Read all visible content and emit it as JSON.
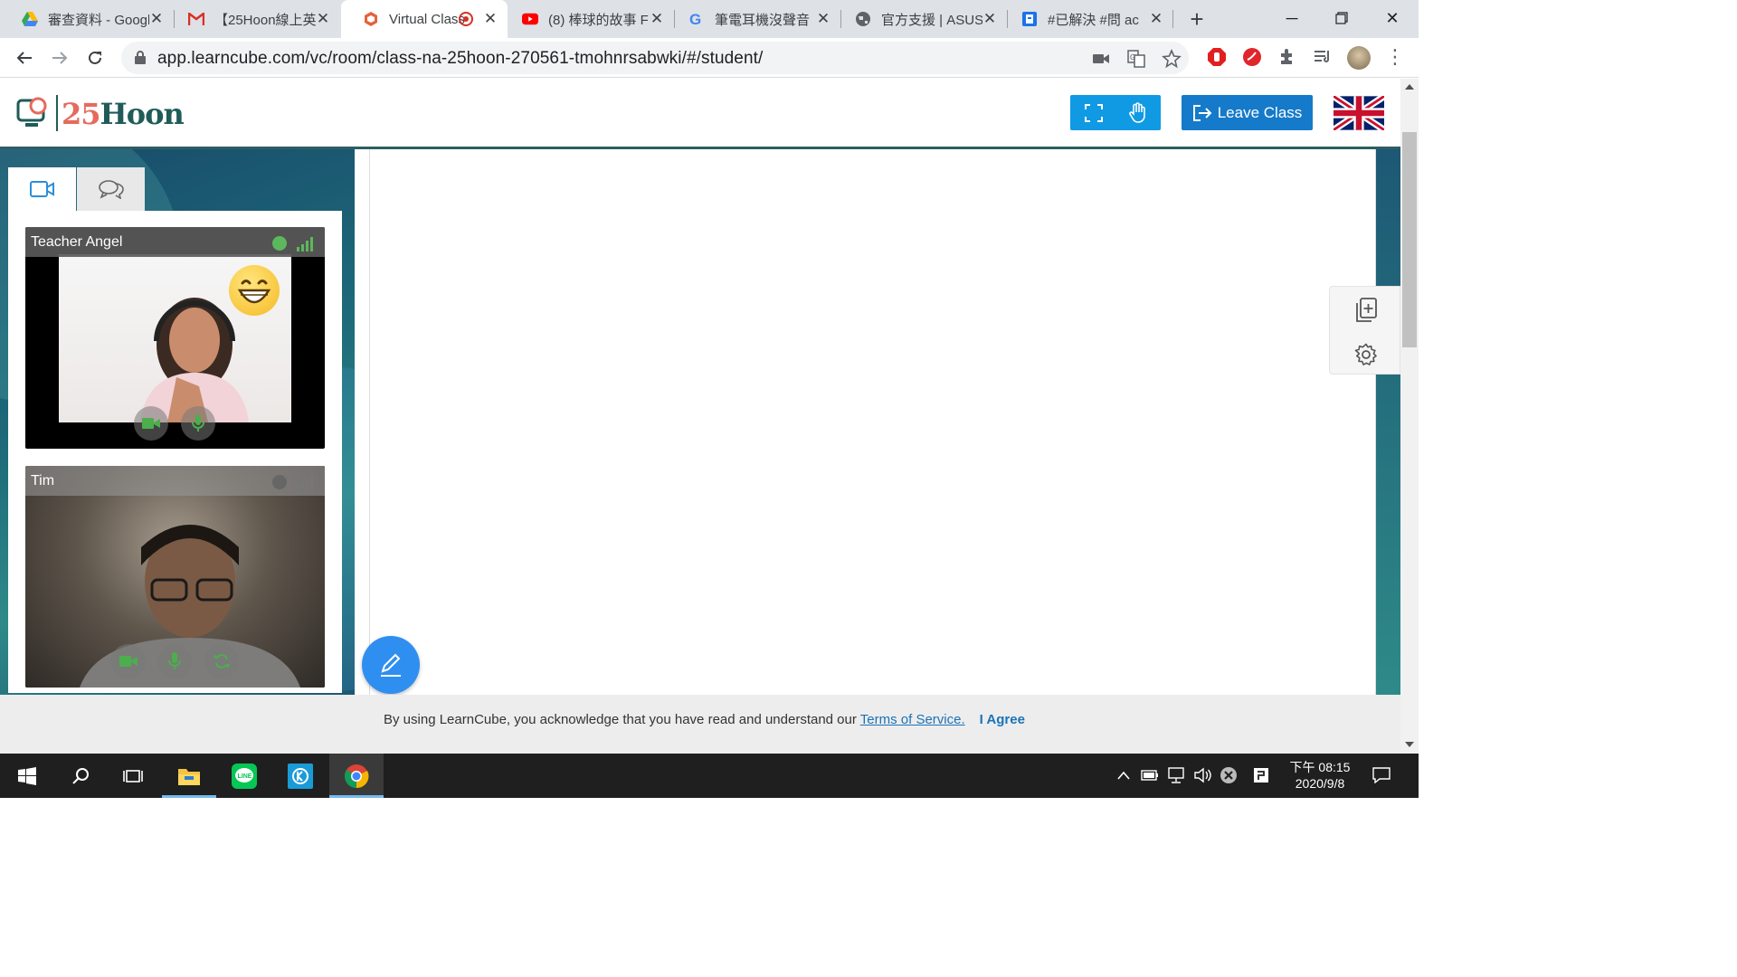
{
  "browser": {
    "tabs": [
      {
        "title": "審查資料 - Google",
        "icon": "google-drive-icon"
      },
      {
        "title": "【25Hoon線上英",
        "icon": "gmail-icon"
      },
      {
        "title": "Virtual Class",
        "icon": "learncube-icon",
        "active": true
      },
      {
        "title": "(8) 棒球的故事 F",
        "icon": "youtube-icon"
      },
      {
        "title": "筆電耳機沒聲音",
        "icon": "google-icon"
      },
      {
        "title": "官方支援 | ASUS",
        "icon": "globe-icon"
      },
      {
        "title": "#已解決 #問 ac",
        "icon": "document-icon"
      }
    ],
    "url": "app.learncube.com/vc/room/class-na-25hoon-270561-tmohnrsabwki/#/student/"
  },
  "app": {
    "logo": {
      "digits": "25",
      "word": "Hoon"
    },
    "leave_label": "Leave Class",
    "language": "English (UK flag)",
    "colors": {
      "accent": "#109ae3",
      "leave": "#157ac9",
      "brand_red": "#e56b5d",
      "brand_teal": "#1f5c58"
    }
  },
  "videos": [
    {
      "name": "Teacher Angel",
      "status_color": "#5cb85c"
    },
    {
      "name": "Tim",
      "status_color": "#666666"
    }
  ],
  "cookie": {
    "text": "By using LearnCube, you acknowledge that you have read and understand our ",
    "link": "Terms of Service.",
    "agree": "I Agree"
  },
  "taskbar": {
    "time": "下午 08:15",
    "date": "2020/9/8"
  }
}
